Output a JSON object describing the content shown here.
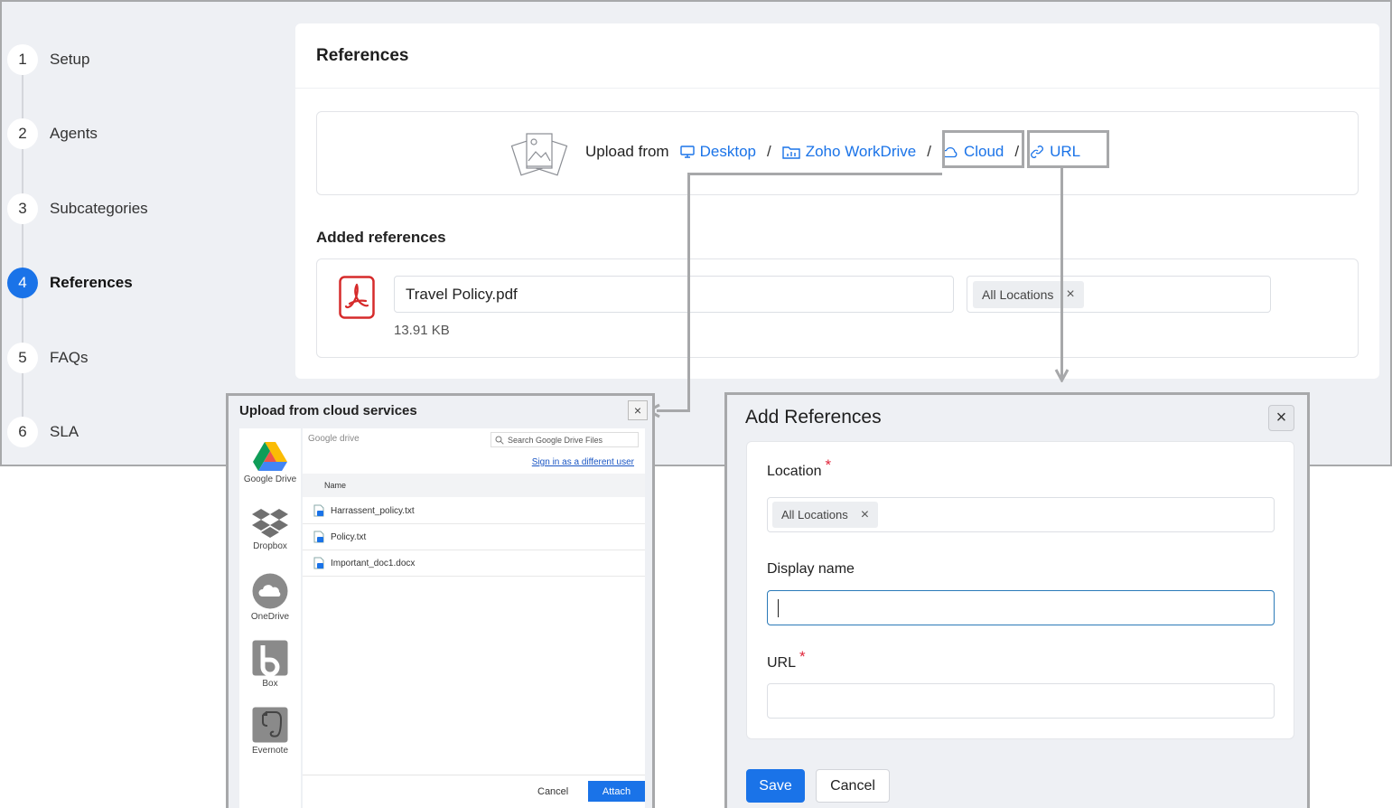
{
  "stepper": {
    "steps": [
      {
        "num": "1",
        "label": "Setup"
      },
      {
        "num": "2",
        "label": "Agents"
      },
      {
        "num": "3",
        "label": "Subcategories"
      },
      {
        "num": "4",
        "label": "References"
      },
      {
        "num": "5",
        "label": "FAQs"
      },
      {
        "num": "6",
        "label": "SLA"
      }
    ],
    "active_step": "4"
  },
  "references": {
    "title": "References",
    "upload_label": "Upload from",
    "sources": {
      "desktop": "Desktop",
      "workdrive": "Zoho WorkDrive",
      "cloud": "Cloud",
      "url": "URL",
      "separator": "/"
    },
    "added_title": "Added references",
    "item": {
      "file_name": "Travel Policy.pdf",
      "file_size": "13.91 KB",
      "location_chip": "All Locations",
      "chip_remove": "×"
    }
  },
  "cloud_modal": {
    "title": "Upload from cloud services",
    "close": "×",
    "services": [
      "Google Drive",
      "Dropbox",
      "OneDrive",
      "Box",
      "Evernote"
    ],
    "path": "Google drive",
    "search_placeholder": "Search Google Drive Files",
    "sign_in_link": "Sign in as a different user",
    "column_name": "Name",
    "files": [
      "Harrassent_policy.txt",
      "Policy.txt",
      "Important_doc1.docx"
    ],
    "cancel": "Cancel",
    "attach": "Attach"
  },
  "add_modal": {
    "title": "Add References",
    "close": "×",
    "location_label": "Location",
    "location_chip": "All Locations",
    "chip_remove": "×",
    "display_name_label": "Display name",
    "display_name_value": "",
    "url_label": "URL",
    "url_value": "",
    "required_mark": "*",
    "save": "Save",
    "cancel": "Cancel"
  },
  "colors": {
    "accent": "#1a73e8",
    "required": "#e0253a",
    "annotation": "#a7a8aa"
  }
}
